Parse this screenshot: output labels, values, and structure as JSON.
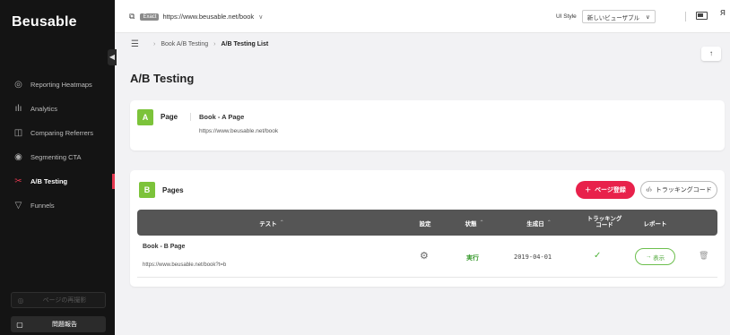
{
  "brand": "Beusable",
  "sidebar": {
    "collapse_icon": "chevron-left",
    "items": [
      {
        "label": "Reporting Heatmaps",
        "icon": "target-icon",
        "glyph": "◎"
      },
      {
        "label": "Analytics",
        "icon": "bar-chart-icon",
        "glyph": "ılı"
      },
      {
        "label": "Comparing Referrers",
        "icon": "compare-icon",
        "glyph": "◫"
      },
      {
        "label": "Segmenting CTA",
        "icon": "fingerprint-icon",
        "glyph": "◉"
      },
      {
        "label": "A/B Testing",
        "icon": "ab-test-icon",
        "glyph": "✂",
        "active": true
      },
      {
        "label": "Funnels",
        "icon": "funnel-icon",
        "glyph": "▽"
      }
    ],
    "reshoot_label": "ページの再撮影",
    "report_label": "問題報告"
  },
  "topbar": {
    "url_badge": "Exact",
    "url": "https://www.beusable.net/book",
    "ui_style_label": "UI Style",
    "ui_style_value": "新しいビューザブル"
  },
  "breadcrumb": {
    "items": [
      "Book A/B Testing",
      "A/B Testing List"
    ]
  },
  "page_title": "A/B Testing",
  "card_a": {
    "tag": "A",
    "label": "Page",
    "page_name": "Book - A Page",
    "page_url": "https://www.beusable.net/book"
  },
  "card_b": {
    "tag": "B",
    "label": "Pages",
    "register_button": "ページ登録",
    "tracking_button": "トラッキングコード",
    "columns": {
      "test": "テスト",
      "settings": "設定",
      "status": "状態",
      "created": "生成日",
      "code_line1": "トラッキング",
      "code_line2": "コード",
      "report": "レポート"
    },
    "rows": [
      {
        "name": "Book - B Page",
        "url": "https://www.beusable.net/book?t=b",
        "status": "実行",
        "created": "2019-04-01",
        "report_button": "表示"
      }
    ]
  },
  "colors": {
    "accent_red": "#e8214b",
    "tag_green": "#7cc33a",
    "status_green": "#3a9b2f"
  }
}
